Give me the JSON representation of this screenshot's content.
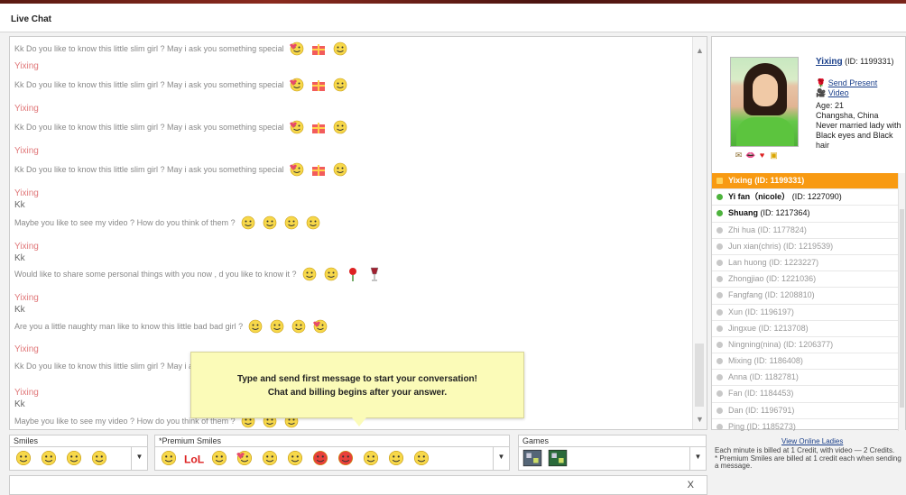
{
  "window": {
    "title": "Live Chat"
  },
  "chat": {
    "messages": [
      {
        "text": "Kk Do you like to know this little slim girl ? May i ask you something special",
        "emotes": [
          "heart-smiley",
          "gift-box",
          "sleepy-smiley"
        ]
      },
      {
        "name": "Yixing"
      },
      {
        "text": "Kk Do you like to know this little slim girl ? May i ask you something special",
        "emotes": [
          "heart-smiley",
          "gift-box",
          "sleepy-smiley"
        ]
      },
      {
        "name": "Yixing"
      },
      {
        "text": "Kk Do you like to know this little slim girl ? May i ask you something special",
        "emotes": [
          "heart-smiley",
          "gift-box",
          "sleepy-smiley"
        ]
      },
      {
        "name": "Yixing"
      },
      {
        "text": "Kk Do you like to know this little slim girl ? May i ask you something special",
        "emotes": [
          "heart-smiley",
          "gift-box",
          "sleepy-smiley"
        ]
      },
      {
        "name": "Yixing"
      },
      {
        "kk": "Kk"
      },
      {
        "text": "Maybe you like to see my video ? How do you think of them ?",
        "emotes": [
          "hello-smiley",
          "angel-smiley",
          "smile",
          "grin"
        ]
      },
      {
        "name": "Yixing"
      },
      {
        "kk": "Kk"
      },
      {
        "text": "Would like to share some personal things with you now , d you like to know it ?",
        "emotes": [
          "flirt-smiley",
          "blush-smiley",
          "rose",
          "wine-glass"
        ]
      },
      {
        "name": "Yixing"
      },
      {
        "kk": "Kk"
      },
      {
        "text": "Are you a little naughty man like to know this little bad bad girl ?",
        "emotes": [
          "angel-smiley",
          "smile",
          "grin",
          "heart-smiley"
        ]
      },
      {
        "name": "Yixing"
      },
      {
        "text": "Kk Do you like to know this little slim girl ? May i ask you something special",
        "emotes": []
      },
      {
        "name": "Yixing"
      },
      {
        "kk": "Kk"
      },
      {
        "text": "Maybe you like to see my video ? How do you think of them ?",
        "emotes": [
          "hello-smiley",
          "angel-smiley",
          "smile"
        ]
      }
    ]
  },
  "tooltip": {
    "line1": "Type and send first message to start your conversation!",
    "line2": "Chat and billing begins after your answer."
  },
  "emoticons": {
    "smiles_label": "Smiles",
    "premium_label": "*Premium Smiles",
    "games_label": "Games",
    "smiles": [
      "angel-smiley",
      "smile",
      "grin",
      "hug-smiley"
    ],
    "premium": [
      "hello-smiley",
      "lol-smiley",
      "shocked-smiley",
      "heart-eyes-smiley",
      "thumbs-smiley",
      "flirt-smiley",
      "devil-smiley",
      "kiss-smiley",
      "sad-smiley",
      "crying-smiley",
      "wink-smiley"
    ],
    "games": [
      "game-board-1",
      "game-board-2"
    ]
  },
  "profile": {
    "name": "Yixing",
    "id_text": "(ID: 1199331)",
    "send_present": "Send Present",
    "video": "Video",
    "age": "Age: 21",
    "location": "Changsha, China",
    "status": "Never married lady with Black eyes and Black hair",
    "icons": [
      "mail-icon",
      "lips-icon",
      "heart-icon",
      "gift-icon"
    ]
  },
  "people": [
    {
      "name": "Yixing",
      "id": "(ID: 1199331)",
      "status": "selected"
    },
    {
      "name": "Yi fan（nicole）",
      "id": "(ID: 1227090)",
      "status": "online"
    },
    {
      "name": "Shuang",
      "id": "(ID: 1217364)",
      "status": "online"
    },
    {
      "name": "Zhi hua",
      "id": "(ID: 1177824)",
      "status": "offline"
    },
    {
      "name": "Jun xian(chris)",
      "id": "(ID: 1219539)",
      "status": "offline"
    },
    {
      "name": "Lan huong",
      "id": "(ID: 1223227)",
      "status": "offline"
    },
    {
      "name": "Zhongjiao",
      "id": "(ID: 1221036)",
      "status": "offline"
    },
    {
      "name": "Fangfang",
      "id": "(ID: 1208810)",
      "status": "offline"
    },
    {
      "name": "Xun",
      "id": "(ID: 1196197)",
      "status": "offline"
    },
    {
      "name": "Jingxue",
      "id": "(ID: 1213708)",
      "status": "offline"
    },
    {
      "name": "Ningning(nina)",
      "id": "(ID: 1206377)",
      "status": "offline"
    },
    {
      "name": "Mixing",
      "id": "(ID: 1186408)",
      "status": "offline"
    },
    {
      "name": "Anna",
      "id": "(ID: 1182781)",
      "status": "offline"
    },
    {
      "name": "Fan",
      "id": "(ID: 1184453)",
      "status": "offline"
    },
    {
      "name": "Dan",
      "id": "(ID: 1196791)",
      "status": "offline"
    },
    {
      "name": "Ping",
      "id": "(ID: 1185273)",
      "status": "offline"
    }
  ],
  "view_all": "View Online Ladies",
  "billing": {
    "line1": "Each minute is billed at 1 Credit, with video — 2 Credits.",
    "line2": "* Premium Smiles are billed at 1 credit each when sending a message."
  },
  "input": {
    "close_glyph": "X"
  },
  "colors": {
    "accent": "#f89a12",
    "link": "#1a3f8a",
    "name": "#e0787a",
    "tooltip": "#fbfbb8"
  }
}
